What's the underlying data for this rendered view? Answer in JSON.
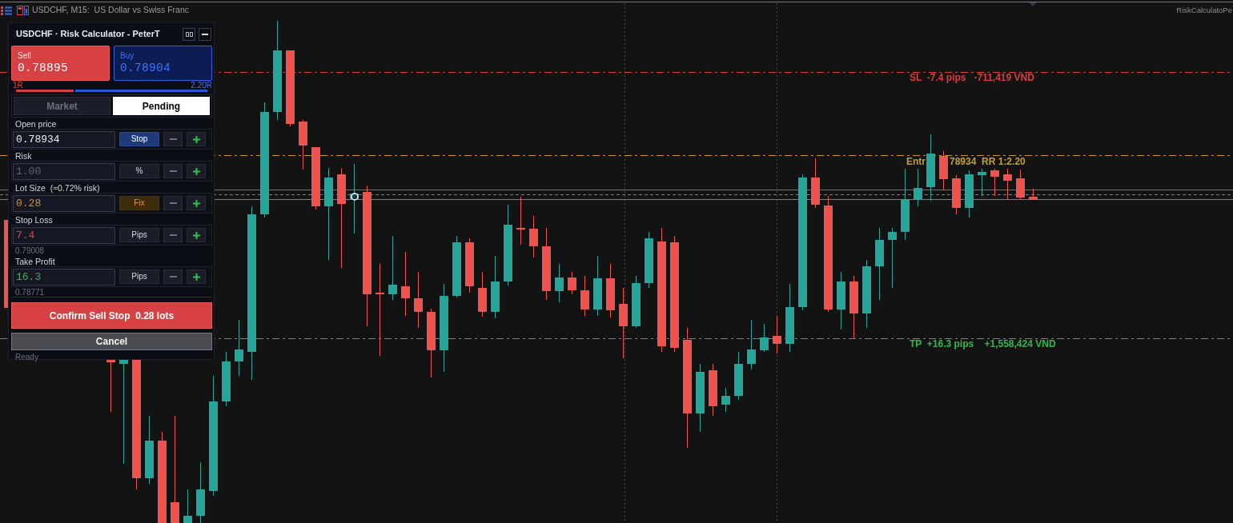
{
  "chart": {
    "title": "USDCHF, M15:  US Dollar vs Swiss Franc",
    "indicator": "RiskCalculatoPe",
    "levels": [
      {
        "kind": "stop_loss",
        "label": "SL  -7.4 pips   -711,419 VND"
      },
      {
        "kind": "entry",
        "label": "Entr",
        "label_after_gap": "78934  RR 1:2.20"
      },
      {
        "kind": "take_profit",
        "label": "TP  +16.3 pips    +1,558,424 VND"
      }
    ]
  },
  "panel": {
    "title": "USDCHF · Risk Calculator - PeterT",
    "quotes": [
      {
        "kind": "sell",
        "label": "Sell",
        "price": "0.78895"
      },
      {
        "kind": "buy",
        "label": "Buy",
        "price": "0.78904"
      }
    ],
    "risk_reward": {
      "left_label": "1R",
      "right_label": "2.20R",
      "level": 0.31
    },
    "tabs": [
      {
        "label": "Market",
        "selected": false
      },
      {
        "label": "Pending",
        "selected": true
      }
    ],
    "fields": [
      {
        "kind": "open_price",
        "label": "Open price",
        "value": "0.78934",
        "unit": "Stop"
      },
      {
        "kind": "risk",
        "label": "Risk",
        "value": "1.00",
        "unit": "%"
      },
      {
        "kind": "lot_size",
        "label": "Lot Size  (≈0.72% risk)",
        "value": "0.28",
        "unit": "Fix"
      },
      {
        "kind": "stop_loss",
        "label": "Stop Loss",
        "value": "7.4",
        "unit": "Pips",
        "price_hint": "0.79008"
      },
      {
        "kind": "take_profit",
        "label": "Take Profit",
        "value": "16.3",
        "unit": "Pips",
        "price_hint": "0.78771"
      }
    ],
    "confirm_button": "Confirm Sell Stop  0.28 lots",
    "cancel_button": "Cancel",
    "status": "Ready"
  }
}
